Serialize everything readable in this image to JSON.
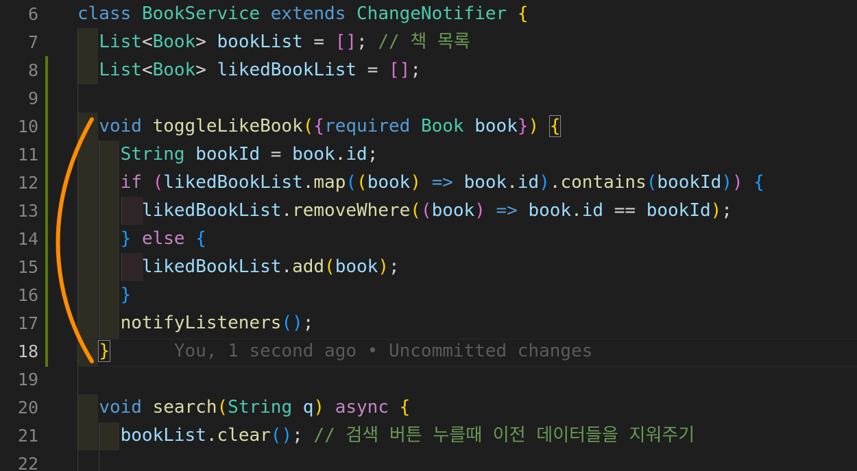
{
  "editor": {
    "line_numbers": [
      "6",
      "7",
      "8",
      "9",
      "10",
      "11",
      "12",
      "13",
      "14",
      "15",
      "16",
      "17",
      "18",
      "19",
      "20",
      "21",
      "22"
    ],
    "current_line": "18",
    "blame": "You, 1 second ago • Uncommitted changes",
    "lines": {
      "l6": [
        "class",
        "BookService",
        "extends",
        "ChangeNotifier",
        "{"
      ],
      "l7": [
        "List",
        "<",
        "Book",
        ">",
        "bookList",
        "=",
        "[",
        "]",
        ";",
        "// 책 목록"
      ],
      "l8": [
        "List",
        "<",
        "Book",
        ">",
        "likedBookList",
        "=",
        "[",
        "]",
        ";"
      ],
      "l10": [
        "void",
        "toggleLikeBook",
        "(",
        "{",
        "required",
        "Book",
        "book",
        "}",
        ")",
        "{"
      ],
      "l11": [
        "String",
        "bookId",
        "=",
        "book",
        ".",
        "id",
        ";"
      ],
      "l12": [
        "if",
        "(",
        "likedBookList",
        ".",
        "map",
        "(",
        "(",
        "book",
        ")",
        "=>",
        "book",
        ".",
        "id",
        ")",
        ".",
        "contains",
        "(",
        "bookId",
        ")",
        ")",
        "{"
      ],
      "l13": [
        "likedBookList",
        ".",
        "removeWhere",
        "(",
        "(",
        "book",
        ")",
        "=>",
        "book",
        ".",
        "id",
        "==",
        "bookId",
        ")",
        ";"
      ],
      "l14": [
        "}",
        "else",
        "{"
      ],
      "l15": [
        "likedBookList",
        ".",
        "add",
        "(",
        "book",
        ")",
        ";"
      ],
      "l16": [
        "}"
      ],
      "l17": [
        "notifyListeners",
        "(",
        ")",
        ";"
      ],
      "l18": [
        "}"
      ],
      "l20": [
        "void",
        "search",
        "(",
        "String",
        "q",
        ")",
        "async",
        "{"
      ],
      "l21": [
        "bookList",
        ".",
        "clear",
        "(",
        ")",
        ";",
        "// 검색 버튼 누를때 이전 데이터들을 지워주기"
      ]
    }
  },
  "colors": {
    "background": "#1e1e1e",
    "keyword": "#569cd6",
    "control": "#c586c0",
    "type": "#4ec9b0",
    "function": "#dcdcaa",
    "variable": "#9cdcfe",
    "comment": "#6a9955",
    "git_added": "#587c0c",
    "annotation": "#ff8c00"
  }
}
